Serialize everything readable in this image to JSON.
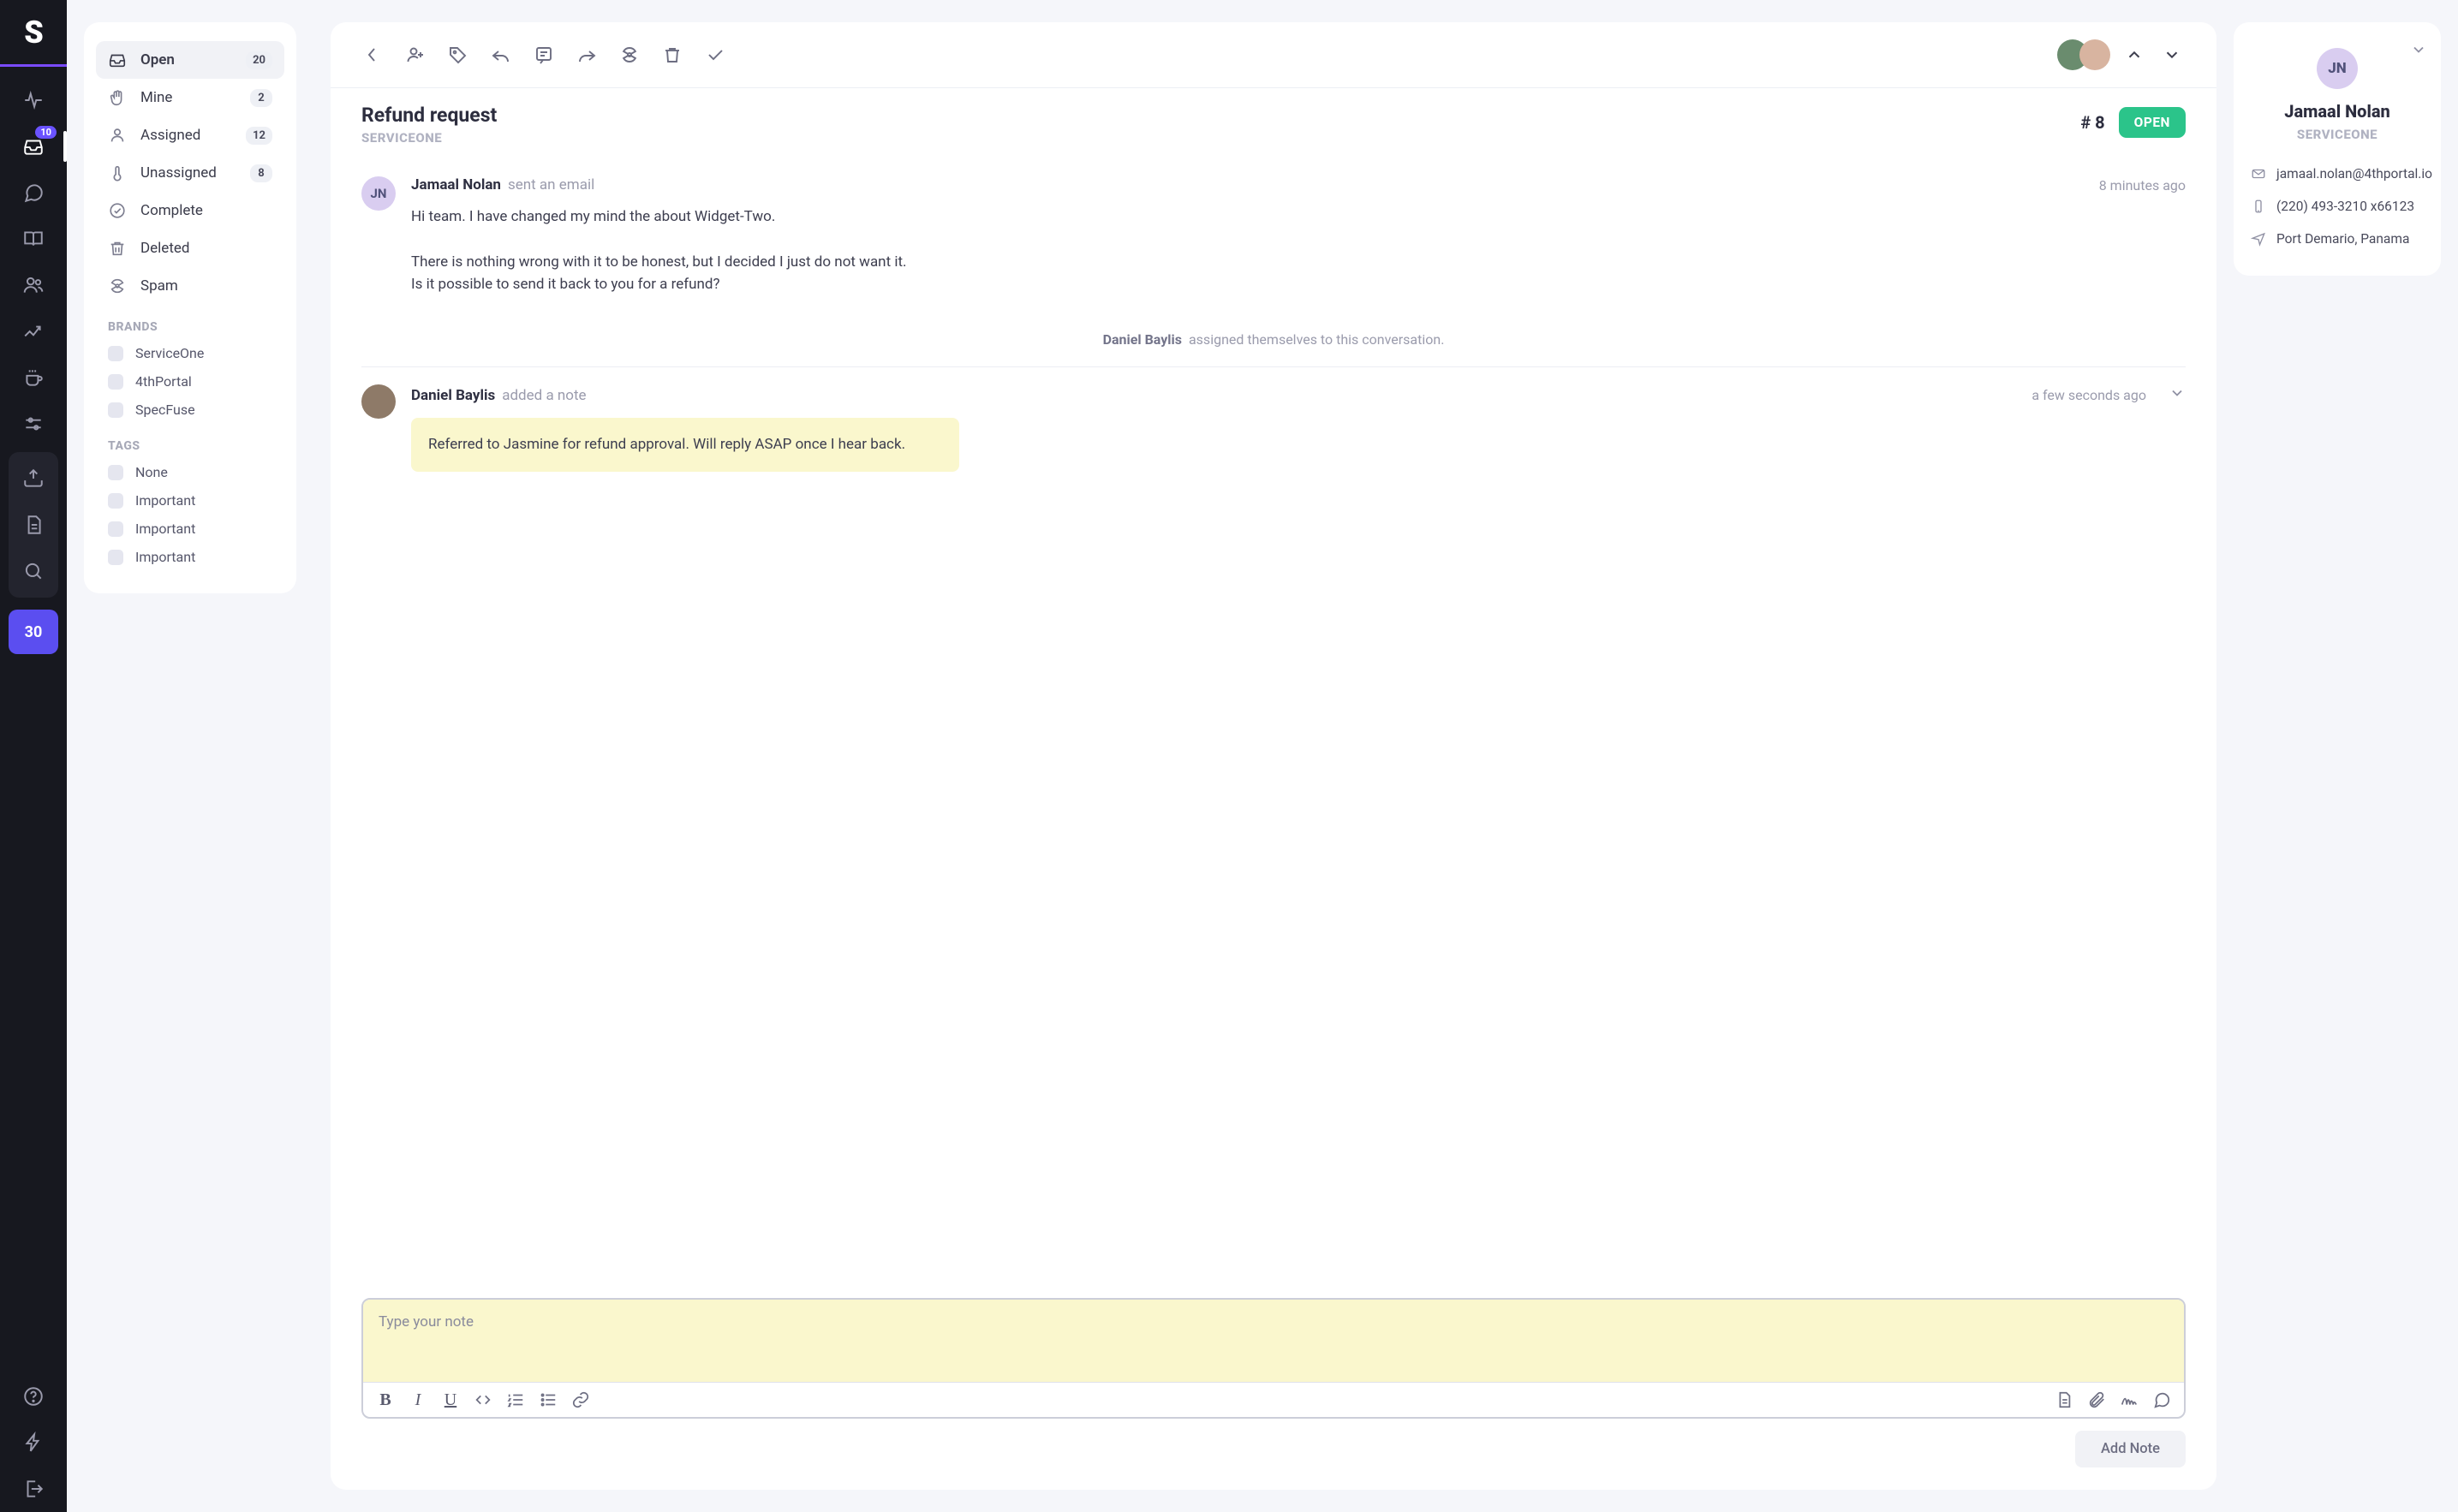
{
  "rail": {
    "badge_inbox": "10",
    "number_chip": "30"
  },
  "sidebar": {
    "folders": [
      {
        "label": "Open",
        "count": "20"
      },
      {
        "label": "Mine",
        "count": "2"
      },
      {
        "label": "Assigned",
        "count": "12"
      },
      {
        "label": "Unassigned",
        "count": "8"
      },
      {
        "label": "Complete",
        "count": ""
      },
      {
        "label": "Deleted",
        "count": ""
      },
      {
        "label": "Spam",
        "count": ""
      }
    ],
    "brands_header": "BRANDS",
    "brands": [
      {
        "label": "ServiceOne"
      },
      {
        "label": "4thPortal"
      },
      {
        "label": "SpecFuse"
      }
    ],
    "tags_header": "TAGS",
    "tags": [
      {
        "label": "None"
      },
      {
        "label": "Important"
      },
      {
        "label": "Important"
      },
      {
        "label": "Important"
      }
    ]
  },
  "conversation": {
    "title": "Refund request",
    "brand": "SERVICEONE",
    "number": "# 8",
    "status": "OPEN",
    "messages": {
      "m0": {
        "author": "Jamaal Nolan",
        "initials": "JN",
        "action": "sent an email",
        "time": "8 minutes ago",
        "avatar_bg": "#d9cdf0",
        "avatar_fg": "#51527a",
        "body": "Hi team. I have changed my mind the about Widget-Two.\n\nThere is nothing wrong with it to be honest, but I decided I just do not want it.\nIs it possible to send it back to you for a refund?"
      },
      "event0": {
        "who": "Daniel Baylis",
        "text": "assigned themselves to this conversation."
      },
      "m1": {
        "author": "Daniel Baylis",
        "action": "added a note",
        "time": "a few seconds ago",
        "avatar_bg": "#7c7ba1",
        "note": "Referred to Jasmine for refund approval. Will reply ASAP once I hear back."
      }
    },
    "composer_placeholder": "Type your note",
    "submit_label": "Add Note"
  },
  "contact": {
    "initials": "JN",
    "name": "Jamaal Nolan",
    "brand": "SERVICEONE",
    "email": "jamaal.nolan@4thportal.io",
    "phone": "(220) 493-3210 x66123",
    "location": "Port Demario, Panama"
  }
}
